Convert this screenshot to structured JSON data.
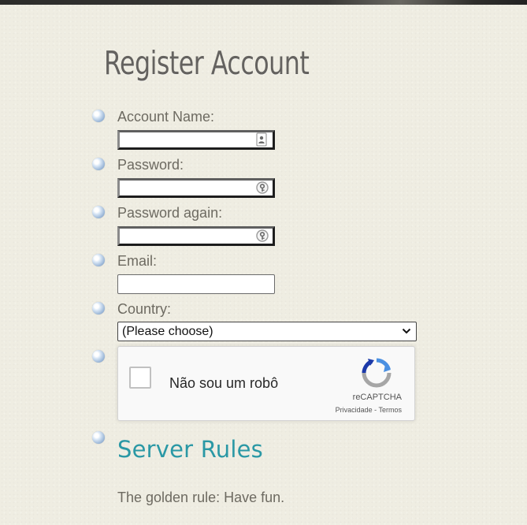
{
  "page_title": "Register Account",
  "form": {
    "account_name_label": "Account Name:",
    "account_name_value": "",
    "password_label": "Password:",
    "password_value": "",
    "password_again_label": "Password again:",
    "password_again_value": "",
    "email_label": "Email:",
    "email_value": "",
    "country_label": "Country:",
    "country_selected": "(Please choose)"
  },
  "recaptcha": {
    "checkbox_label": "Não sou um robô",
    "brand": "reCAPTCHA",
    "privacy_link": "Privacidade",
    "separator": " - ",
    "terms_link": "Termos"
  },
  "rules": {
    "heading": "Server Rules",
    "text": "The golden rule: Have fun."
  },
  "icons": {
    "bullet": "blue-orb-bullet-icon",
    "account_field": "contact-card-icon",
    "password_field": "key-lock-icon",
    "select": "chevron-down-icon",
    "recaptcha": "recaptcha-logo-icon"
  },
  "colors": {
    "background": "#efede2",
    "title": "#64625f",
    "label": "#6d6a61",
    "heading_accent": "#2a98a5"
  }
}
